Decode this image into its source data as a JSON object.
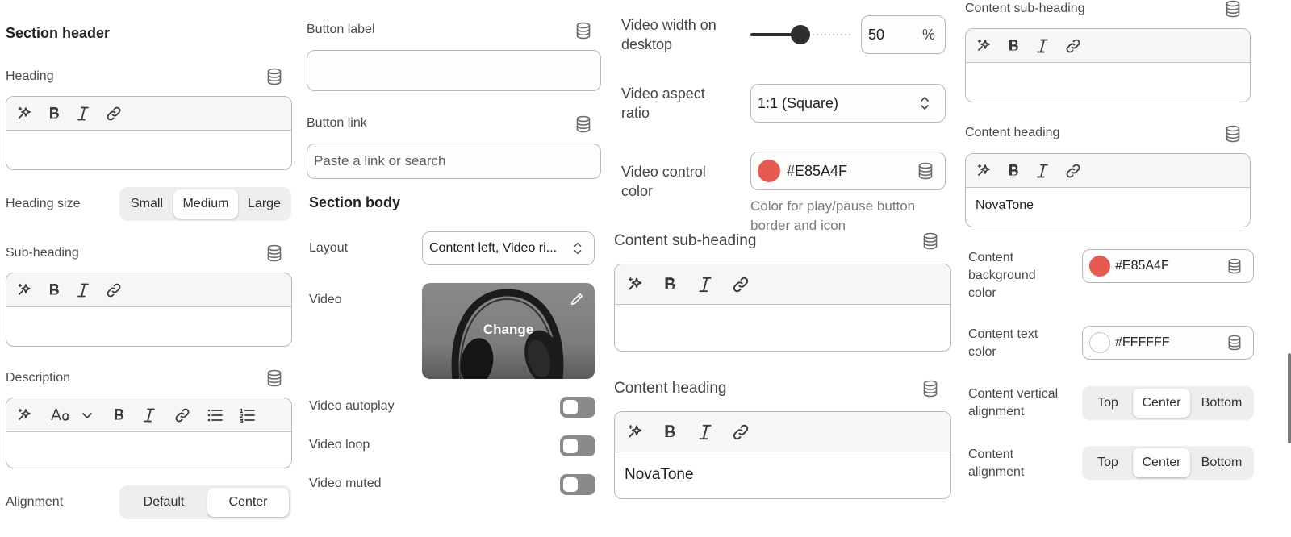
{
  "col1": {
    "section_header": "Section header",
    "heading_label": "Heading",
    "heading_size_label": "Heading size",
    "heading_size_options": [
      "Small",
      "Medium",
      "Large"
    ],
    "heading_size_selected": "Medium",
    "subheading_label": "Sub-heading",
    "description_label": "Description",
    "alignment_label": "Alignment",
    "alignment_options": [
      "Default",
      "Center"
    ],
    "alignment_selected": "Center"
  },
  "col2": {
    "button_label_label": "Button label",
    "button_label_value": "",
    "button_link_label": "Button link",
    "button_link_placeholder": "Paste a link or search",
    "section_body": "Section body",
    "layout_label": "Layout",
    "layout_value": "Content left, Video ri...",
    "video_label": "Video",
    "video_change": "Change",
    "video_autoplay_label": "Video autoplay",
    "video_loop_label": "Video loop",
    "video_muted_label": "Video muted"
  },
  "col3": {
    "video_width_label": "Video width on desktop",
    "video_width_value": "50",
    "video_width_unit": "%",
    "video_width_fraction": 0.5,
    "aspect_label": "Video aspect ratio",
    "aspect_value": "1:1 (Square)",
    "control_color_label": "Video control color",
    "control_color_value": "#E85A4F",
    "control_color_help": "Color for play/pause button border and icon",
    "content_subheading_label": "Content sub-heading",
    "content_heading_label": "Content heading",
    "content_heading_value": "NovaTone"
  },
  "col4": {
    "content_subheading_label": "Content sub-heading",
    "content_heading_label": "Content heading",
    "content_heading_value": "NovaTone",
    "bg_color_label": "Content background color",
    "bg_color_value": "#E85A4F",
    "text_color_label": "Content text color",
    "text_color_value": "#FFFFFF",
    "vertical_label": "Content vertical alignment",
    "vertical_options": [
      "Top",
      "Center",
      "Bottom"
    ],
    "vertical_selected": "Center",
    "align_label": "Content alignment",
    "align_options": [
      "Top",
      "Center",
      "Bottom"
    ],
    "align_selected": "Center"
  },
  "colors": {
    "accent_red": "#E85A4F",
    "white": "#FFFFFF"
  }
}
